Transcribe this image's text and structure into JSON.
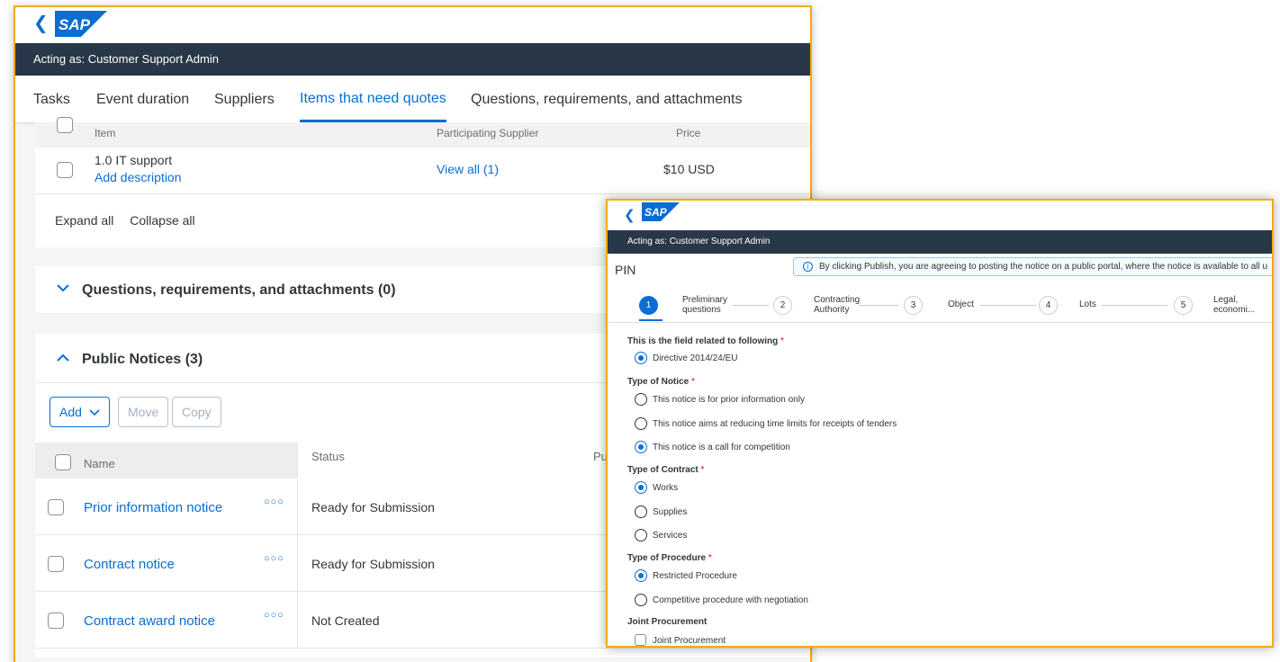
{
  "colors": {
    "accent": "#0a6ed1",
    "shell": "#283848",
    "highlight_border": "#f0ab00"
  },
  "window1": {
    "brand": "SAP",
    "acting_as": "Acting as: Customer Support Admin",
    "tabs": [
      {
        "label": "Tasks"
      },
      {
        "label": "Event duration"
      },
      {
        "label": "Suppliers"
      },
      {
        "label": "Items that need quotes",
        "active": true
      },
      {
        "label": "Questions, requirements, and attachments"
      }
    ],
    "items_table": {
      "headers": {
        "item": "Item",
        "supplier": "Participating Supplier",
        "price": "Price"
      },
      "row": {
        "item": "1.0 IT support",
        "description_link": "Add description",
        "supplier_link": "View all (1)",
        "price": "$10 USD"
      },
      "expand_all": "Expand all",
      "collapse_all": "Collapse all"
    },
    "questions_section": {
      "title": "Questions, requirements, and attachments (0)",
      "expanded": false
    },
    "public_notices": {
      "title": "Public Notices (3)",
      "expanded": true,
      "buttons": {
        "add": "Add",
        "move": "Move",
        "copy": "Copy"
      },
      "headers": {
        "name": "Name",
        "status": "Status",
        "third": "Pu"
      },
      "rows": [
        {
          "name": "Prior information notice",
          "status": "Ready for Submission"
        },
        {
          "name": "Contract notice",
          "status": "Ready for Submission"
        },
        {
          "name": "Contract award notice",
          "status": "Not Created"
        }
      ]
    }
  },
  "window2": {
    "brand": "SAP",
    "acting_as": "Acting as: Customer Support Admin",
    "title": "PIN",
    "info_message": "By clicking Publish, you are agreeing to posting the notice on a public portal, where the notice is available to all u",
    "steps": [
      {
        "num": "1",
        "label_l1": "Preliminary",
        "label_l2": "questions",
        "active": true
      },
      {
        "num": "2",
        "label_l1": "Contracting",
        "label_l2": "Authority"
      },
      {
        "num": "3",
        "label_l1": "Object",
        "label_l2": ""
      },
      {
        "num": "4",
        "label_l1": "Lots",
        "label_l2": ""
      },
      {
        "num": "5",
        "label_l1": "Legal,",
        "label_l2": "economi..."
      }
    ],
    "fields": {
      "field_related": {
        "label": "This is the field related to following",
        "required": "*",
        "options": [
          {
            "label": "Directive 2014/24/EU",
            "selected": true
          }
        ]
      },
      "notice_type": {
        "label": "Type of Notice",
        "required": "*",
        "options": [
          {
            "label": "This notice is for prior information only",
            "selected": false
          },
          {
            "label": "This notice aims at reducing time limits for receipts of tenders",
            "selected": false
          },
          {
            "label": "This notice is a call for competition",
            "selected": true
          }
        ]
      },
      "contract_type": {
        "label": "Type of Contract",
        "required": "*",
        "options": [
          {
            "label": "Works",
            "selected": true
          },
          {
            "label": "Supplies",
            "selected": false
          },
          {
            "label": "Services",
            "selected": false
          }
        ]
      },
      "procedure_type": {
        "label": "Type of Procedure",
        "required": "*",
        "options": [
          {
            "label": "Restricted Procedure",
            "selected": true
          },
          {
            "label": "Competitive procedure with negotiation",
            "selected": false
          }
        ]
      },
      "joint_procurement": {
        "label": "Joint Procurement",
        "checkbox_label": "Joint Procurement",
        "checked": false
      }
    }
  }
}
